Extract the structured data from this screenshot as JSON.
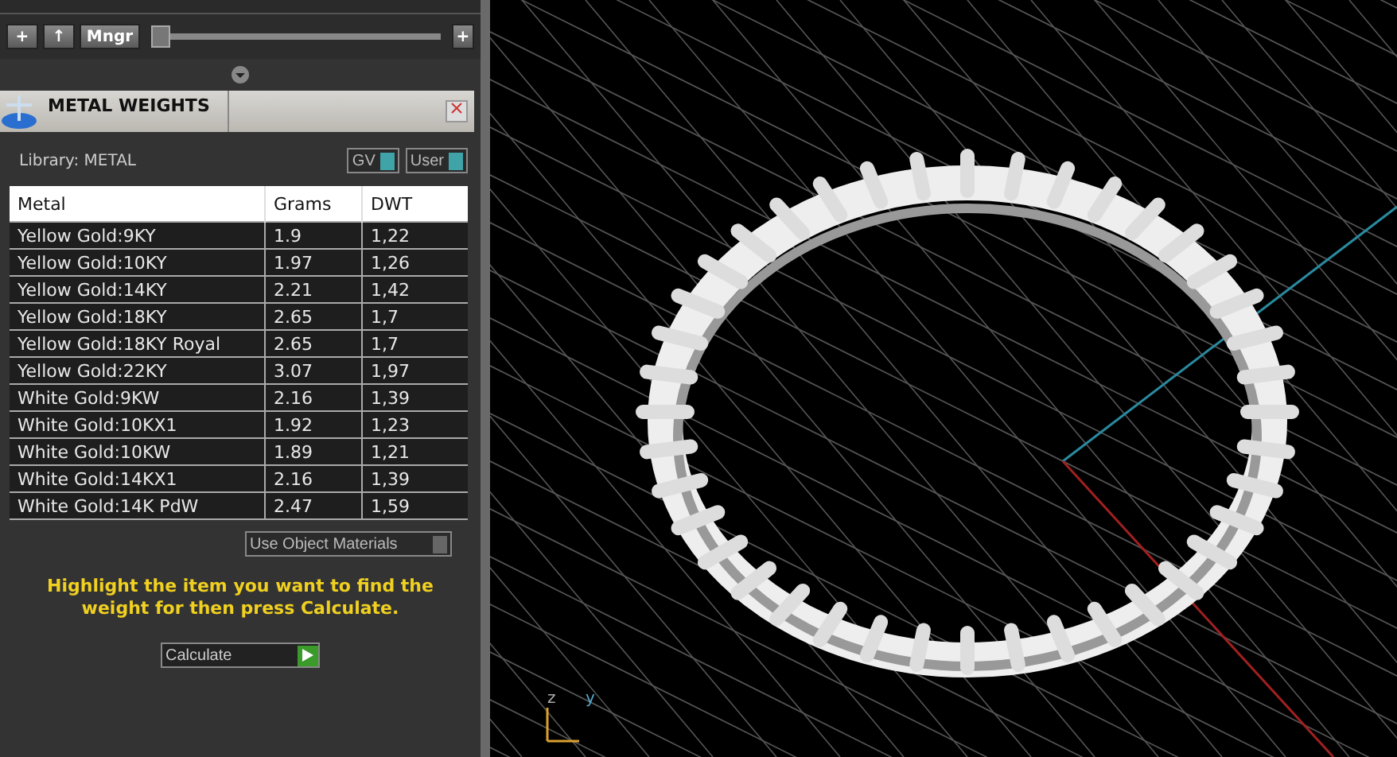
{
  "toolbar": {
    "buttons": [
      {
        "kind": "icon",
        "label": "+"
      },
      {
        "kind": "icon",
        "label": "↑"
      },
      {
        "kind": "text",
        "label": "Mngr"
      }
    ],
    "zoom_slider": {
      "level": 0
    },
    "zoom_plus": "+"
  },
  "panel": {
    "title": "METAL WEIGHTS",
    "library": "Library: METAL",
    "toggles": [
      {
        "label": "GV",
        "on": true
      },
      {
        "label": "User",
        "on": true
      }
    ],
    "table": {
      "columns": [
        "Metal",
        "Grams",
        "DWT"
      ],
      "rows": [
        {
          "metal": "Yellow Gold:9KY",
          "grams": "1.9",
          "dwt": "1,22"
        },
        {
          "metal": "Yellow Gold:10KY",
          "grams": "1.97",
          "dwt": "1,26"
        },
        {
          "metal": "Yellow Gold:14KY",
          "grams": "2.21",
          "dwt": "1,42"
        },
        {
          "metal": "Yellow Gold:18KY",
          "grams": "2.65",
          "dwt": "1,7"
        },
        {
          "metal": "Yellow Gold:18KY Royal",
          "grams": "2.65",
          "dwt": "1,7"
        },
        {
          "metal": "Yellow Gold:22KY",
          "grams": "3.07",
          "dwt": "1,97"
        },
        {
          "metal": "White Gold:9KW",
          "grams": "2.16",
          "dwt": "1,39"
        },
        {
          "metal": "White Gold:10KX1",
          "grams": "1.92",
          "dwt": "1,23"
        },
        {
          "metal": "White Gold:10KW",
          "grams": "1.89",
          "dwt": "1,21"
        },
        {
          "metal": "White Gold:14KX1",
          "grams": "2.16",
          "dwt": "1,39"
        },
        {
          "metal": "White Gold:14K PdW",
          "grams": "2.47",
          "dwt": "1,59"
        }
      ]
    },
    "use_object_materials": {
      "label": "Use Object Materials",
      "on": false
    },
    "hint": "Highlight the item you want to find the weight for then press Calculate.",
    "calculate": "Calculate"
  },
  "viewport": {
    "axis_labels": [
      "z",
      "y"
    ]
  }
}
